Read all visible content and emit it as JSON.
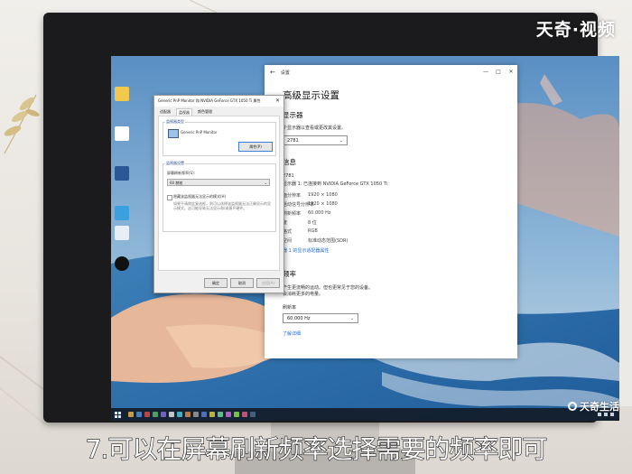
{
  "watermarks": {
    "top_logo": "天奇·视频",
    "bottom_logo": "天奇生活"
  },
  "subtitle": "7.可以在屏幕刷新频率选择需要的频率即可",
  "settings_window": {
    "title": "设置",
    "window_controls": [
      "—",
      "□",
      "✕"
    ],
    "heading": "高级显示设置",
    "section_display_select": "显示器",
    "choose_display_text": "个显示器以查看或更改其设置。",
    "display_dropdown_value": "2781",
    "section_info": "信息",
    "info_line_1": "2781",
    "info_line_2": "显示器 1: 已连接到 NVIDIA GeForce GTX 1050 Ti",
    "info_rows": [
      {
        "key": "面分辨率",
        "value": "1920 × 1080"
      },
      {
        "key": "活动信号分辨率",
        "value": "1920 × 1080"
      },
      {
        "key": "刷新频率",
        "value": "60.000 Hz"
      },
      {
        "key": "度",
        "value": "8 位"
      },
      {
        "key": "格式",
        "value": "RGB"
      },
      {
        "key": "空间",
        "value": "标准动态范围(SDR)"
      }
    ],
    "adapter_link": "器 1 的显示适配器属性",
    "section_refresh": "频率",
    "refresh_desc_1": "产生更流畅的运动。但也更常见于您的设备。",
    "refresh_desc_2": "会消耗更多的电量。",
    "refresh_label": "刷新率",
    "refresh_dropdown_value": "60.000 Hz",
    "learn_more_link": "了解详细"
  },
  "properties_dialog": {
    "title": "Generic PnP Monitor 和 NVIDIA GeForce GTX 1050 Ti 属性",
    "close_glyph": "✕",
    "tabs": [
      "适配器",
      "监视器",
      "颜色管理"
    ],
    "active_tab_index": 1,
    "monitor_type_group": "监视器类型",
    "monitor_name": "Generic PnP Monitor",
    "properties_button": "属性(P)",
    "monitor_settings_group": "监视器设置",
    "refresh_rate_label": "屏幕刷新频率(S):",
    "refresh_rate_value": "60 赫兹",
    "hide_modes_label": "隐藏该监视器无法显示的模式(H)",
    "hide_modes_desc": "如果不清除此复选框，则可以选择该监视器无法正确显示的显示模式。这可能导致无法显示和/或损坏硬件。",
    "buttons": {
      "ok": "确定",
      "cancel": "取消",
      "apply": "应用(A)"
    }
  },
  "taskbar": {
    "app_colors": [
      "#e0b24a",
      "#4a8fd8",
      "#d84a4a",
      "#52b86a",
      "#8a6ad8",
      "#e0e0e0",
      "#4ac8d8",
      "#d88a4a",
      "#9a9a9a",
      "#5a7ad8",
      "#d8c84a",
      "#6ad89a",
      "#c86ad8",
      "#8ad84a",
      "#d85a8a",
      "#4a6a8a"
    ]
  },
  "desktop_icons": [
    "folder-icon",
    "file-icon",
    "word-icon",
    "network-icon",
    "pc-icon",
    "qq-icon"
  ]
}
